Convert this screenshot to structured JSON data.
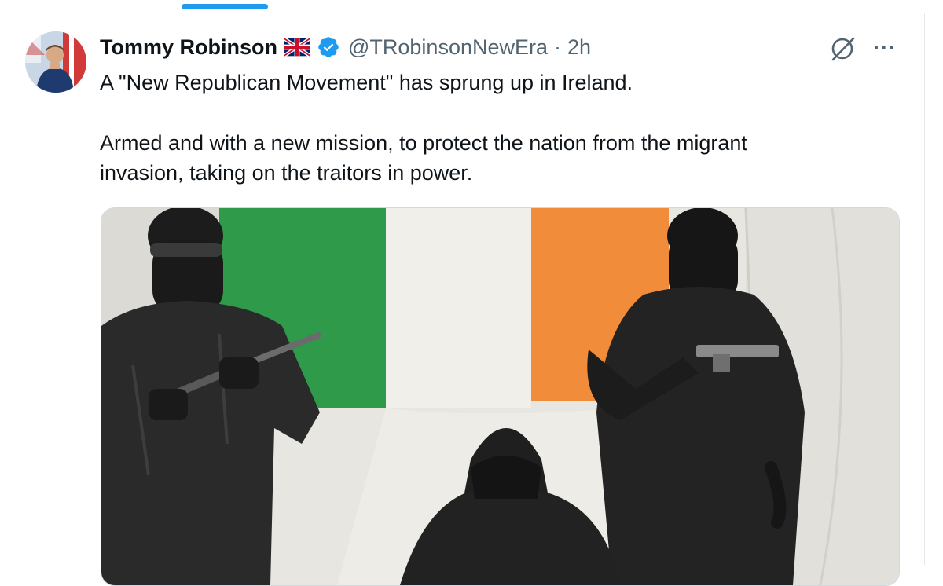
{
  "tweet": {
    "author_name": "Tommy Robinson",
    "author_handle": "@TRobinsonNewEra",
    "separator": "·",
    "timestamp": "2h",
    "text_line1": "A \"New Republican Movement\" has sprung up in Ireland.",
    "text_para2_line1": "Armed and with a new mission, to protect the nation from the migrant",
    "text_para2_line2": "invasion, taking on the traitors in power.",
    "more_label": "···"
  },
  "colors": {
    "accent": "#1d9bf0",
    "text_primary": "#0f1419",
    "text_secondary": "#536471",
    "flag_green": "#2e9a4a",
    "flag_white": "#f1efea",
    "flag_orange": "#f08c3a"
  },
  "icons": {
    "flag": "uk-flag-icon",
    "verified": "verified-badge-icon",
    "grok": "grok-icon",
    "more": "more-icon"
  }
}
